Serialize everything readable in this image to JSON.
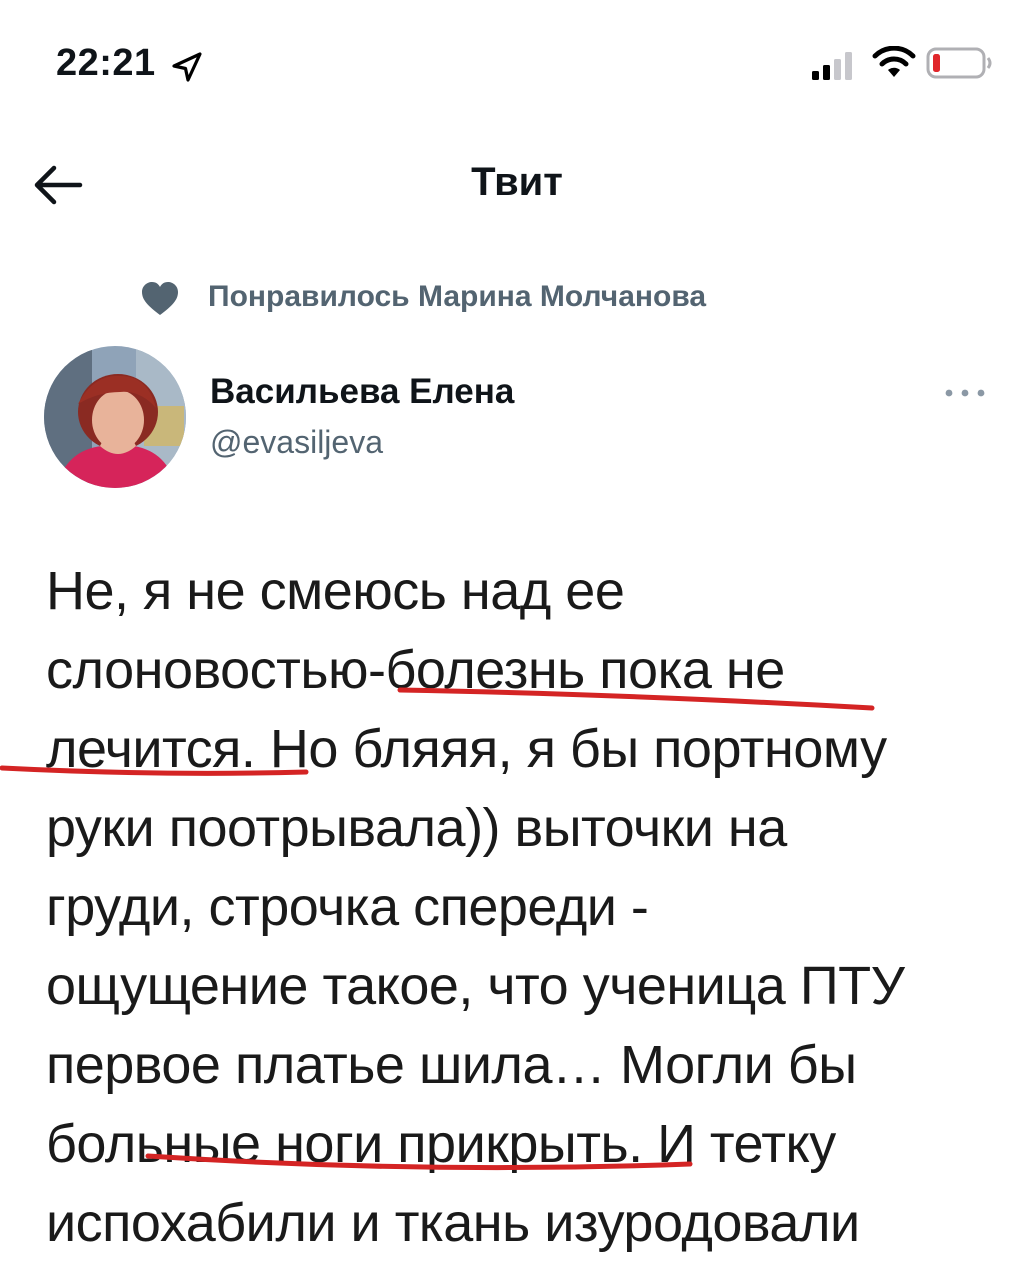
{
  "status_bar": {
    "time": "22:21",
    "icons": [
      "location-arrow-icon",
      "cellular-signal-icon",
      "wifi-icon",
      "battery-low-icon"
    ],
    "battery_color": "#e0262b"
  },
  "nav": {
    "back_icon": "arrow-left-icon",
    "title": "Твит"
  },
  "social_context": {
    "icon": "heart-icon",
    "text": "Понравилось Марина Молчанова"
  },
  "author": {
    "name": "Васильева Елена",
    "handle": "@evasiljeva",
    "more_icon": "ellipsis-icon"
  },
  "tweet": {
    "lines": [
      "Не, я не смеюсь над ее",
      "слоновостью-болезнь пока не",
      "лечится. Но бляяя, я бы портному",
      "руки поотрывала)) выточки на",
      "груди, строчка спереди -",
      "ощущение такое, что ученица ПТУ",
      "первое платье шила… Могли бы",
      "больные ноги прикрыть. И тетку",
      "испохабили и ткань изуродовали"
    ]
  },
  "colors": {
    "text": "#0f1419",
    "secondary": "#536471",
    "annotation": "#d42424"
  }
}
